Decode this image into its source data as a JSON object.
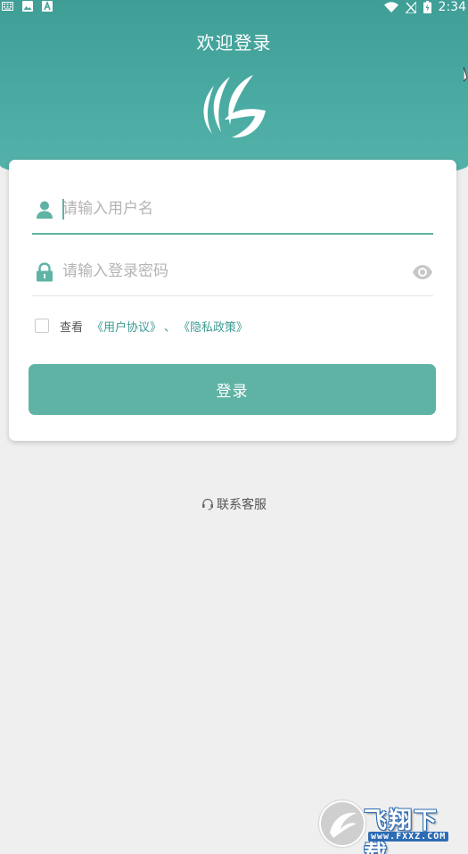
{
  "status_bar": {
    "time": "2:34",
    "left_icons": [
      "keyboard-icon",
      "image-icon",
      "a-letter-icon"
    ],
    "right_icons": [
      "wifi-icon",
      "no-sim-icon",
      "battery-icon"
    ]
  },
  "header": {
    "title": "欢迎登录",
    "logo_icon": "leaf-logo-icon"
  },
  "form": {
    "username": {
      "placeholder": "请输入用户名",
      "value": "",
      "icon": "user-icon"
    },
    "password": {
      "placeholder": "请输入登录密码",
      "value": "",
      "icon": "lock-icon",
      "toggle_icon": "eye-icon"
    },
    "agreement": {
      "checked": false,
      "prefix": "查看",
      "link_user_agreement": "《用户协议》",
      "separator": "、",
      "link_privacy_policy": "《隐私政策》"
    },
    "login_label": "登录"
  },
  "support": {
    "label": "联系客服",
    "icon": "headset-icon"
  },
  "watermark": {
    "title": "飞翔下载",
    "subtitle": "www.FXXZ.COM"
  },
  "colors": {
    "header_top": "#3f9e96",
    "header_bottom": "#55b3aa",
    "accent": "#5fb3a4",
    "link": "#3d9c93",
    "background": "#efefef",
    "card": "#ffffff"
  }
}
